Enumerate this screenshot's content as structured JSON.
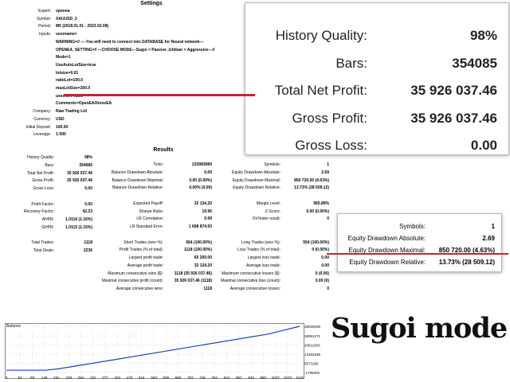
{
  "settings": {
    "title": "Settings",
    "rows": [
      {
        "label": "Expert:",
        "value": "openea"
      },
      {
        "label": "Symbol:",
        "value": "XAUUSD_2"
      },
      {
        "label": "Period:",
        "value": "M5 (2018.01.01 - 2023.02.08)"
      },
      {
        "label": "Inputs:",
        "value": "username="
      },
      {
        "label": "",
        "value": "WARNING=// ----You will need to connect into DATABASE for Neural network---"
      },
      {
        "label": "",
        "value": "OPENEA_SETTING=// ---CHOOSE MODE---Sugoi = Passive ,Ichiban = Aggressive---//"
      },
      {
        "label": "",
        "value": "Mode=1"
      },
      {
        "label": "",
        "value": "UseAutoLotSize=true"
      },
      {
        "label": "",
        "value": "lotsize=0.01"
      },
      {
        "label": "",
        "value": "ratioLot=100.0"
      },
      {
        "label": "",
        "value": "maxLotSize=200.0"
      },
      {
        "label": "",
        "value": "useAlert=false"
      },
      {
        "label": "",
        "value": "Comments=OpenEA//IorexEA"
      },
      {
        "label": "Company:",
        "value": "Raw Trading Ltd"
      },
      {
        "label": "Currency:",
        "value": "USD"
      },
      {
        "label": "Initial Deposit:",
        "value": "100.00"
      },
      {
        "label": "Leverage:",
        "value": "1:500"
      }
    ]
  },
  "results": {
    "title": "Results",
    "col1": [
      {
        "label": "History Quality:",
        "value": "98%"
      },
      {
        "label": "Bars:",
        "value": "354085"
      },
      {
        "label": "Total Net Profit:",
        "value": "35 926 037.46"
      },
      {
        "label": "Gross Profit:",
        "value": "35 926 037.46"
      },
      {
        "label": "Gross Loss:",
        "value": "0.00"
      },
      {
        "label": "",
        "value": ""
      },
      {
        "label": "Profit Factor:",
        "value": "0.00"
      },
      {
        "label": "Recovery Factor:",
        "value": "42.23"
      },
      {
        "label": "AHPR:",
        "value": "1.0116 (1.16%)"
      },
      {
        "label": "GHPR:",
        "value": "1.0115 (1.15%)"
      },
      {
        "label": "",
        "value": ""
      },
      {
        "label": "Total Trades:",
        "value": "1118"
      },
      {
        "label": "Total Deals:",
        "value": "2236"
      }
    ],
    "col2": [
      {
        "label": "",
        "value": ""
      },
      {
        "label": "Ticks:",
        "value": "233983089"
      },
      {
        "label": "Balance Drawdown Absolute:",
        "value": "0.00"
      },
      {
        "label": "Balance Drawdown Maximal:",
        "value": "0.00 (0.00%)"
      },
      {
        "label": "Balance Drawdown Relative:",
        "value": "0.00% (0.00)"
      },
      {
        "label": "",
        "value": ""
      },
      {
        "label": "Expected Payoff:",
        "value": "32 134.20"
      },
      {
        "label": "Sharpe Ratio:",
        "value": "19.96"
      },
      {
        "label": "LR Correlation:",
        "value": "0.99"
      },
      {
        "label": "LR Standard Error:",
        "value": "1 608 874.93"
      },
      {
        "label": "",
        "value": ""
      },
      {
        "label": "Short Trades (won %):",
        "value": "564 (100.00%)"
      },
      {
        "label": "Profit Trades (% of total):",
        "value": "1118 (100.00%)"
      },
      {
        "label": "Largest profit trade:",
        "value": "65 200.00"
      },
      {
        "label": "Average profit trade:",
        "value": "32 134.20"
      },
      {
        "label": "Maximum consecutive wins ($):",
        "value": "1118 (35 926 037.46)"
      },
      {
        "label": "Maximal consecutive profit (count):",
        "value": "35 926 037.46 (1118)"
      },
      {
        "label": "Average consecutive wins:",
        "value": "1118"
      }
    ],
    "col3": [
      {
        "label": "",
        "value": ""
      },
      {
        "label": "Symbols:",
        "value": "1"
      },
      {
        "label": "Equity Drawdown Absolute:",
        "value": "2.69"
      },
      {
        "label": "Equity Drawdown Maximal:",
        "value": "850 720.00 (4.63%)"
      },
      {
        "label": "Equity Drawdown Relative:",
        "value": "13.73% (28 509.12)"
      },
      {
        "label": "",
        "value": ""
      },
      {
        "label": "Margin Level:",
        "value": "965.89%"
      },
      {
        "label": "Z-Score:",
        "value": "0.00 (0.00%)"
      },
      {
        "label": "OnTester result:",
        "value": "0"
      },
      {
        "label": "",
        "value": ""
      },
      {
        "label": "",
        "value": ""
      },
      {
        "label": "Long Trades (won %):",
        "value": "554 (100.00%)"
      },
      {
        "label": "Loss Trades (% of total):",
        "value": "0 (0.00%)"
      },
      {
        "label": "Largest loss trade:",
        "value": "0.00"
      },
      {
        "label": "Average loss trade:",
        "value": "0.00"
      },
      {
        "label": "Maximum consecutive losses ($):",
        "value": "0 (0.00)"
      },
      {
        "label": "Maximal consecutive loss (count):",
        "value": "0.00 (0)"
      },
      {
        "label": "Average consecutive losses:",
        "value": "0"
      }
    ]
  },
  "zoom1": {
    "rows": [
      {
        "label": "History Quality:",
        "value": "98%"
      },
      {
        "label": "Bars:",
        "value": "354085"
      },
      {
        "label": "Total Net Profit:",
        "value": "35 926 037.46"
      },
      {
        "label": "Gross Profit:",
        "value": "35 926 037.46"
      },
      {
        "label": "Gross Loss:",
        "value": "0.00"
      }
    ],
    "highlight_color": "#c0272d"
  },
  "zoom2": {
    "rows": [
      {
        "label": "Symbols:",
        "value": "1"
      },
      {
        "label": "Equity Drawdown Absolute:",
        "value": "2.69"
      },
      {
        "label": "Equity Drawdown Maximal:",
        "value": "850 720.00 (4.63%)"
      },
      {
        "label": "Equity Drawdown Relative:",
        "value": "13.73% (28 509.12)"
      }
    ]
  },
  "caption": "Sugoi mode",
  "chart_data": {
    "type": "line",
    "title": "Balance",
    "x_ticks": [
      "0",
      "52",
      "99",
      "145",
      "191",
      "238",
      "284",
      "331",
      "377",
      "423",
      "470",
      "516",
      "563",
      "609",
      "655",
      "702",
      "748",
      "794",
      "841",
      "887",
      "934",
      "980",
      "1027",
      "1073",
      "1119"
    ],
    "y_ticks": [
      "35930639",
      "28081271",
      "20611903",
      "13162535",
      "5673166",
      "-1796202"
    ],
    "ylim": [
      -1796202,
      35930639
    ],
    "xlim": [
      0,
      1119
    ],
    "series": [
      {
        "values": [
          [
            0,
            100
          ],
          [
            150,
            200
          ],
          [
            200,
            1200000
          ],
          [
            400,
            8200000
          ],
          [
            600,
            15300000
          ],
          [
            800,
            22500000
          ],
          [
            1000,
            29600000
          ],
          [
            1119,
            35926037
          ]
        ],
        "color": "#1f3fbf"
      }
    ],
    "grid": true
  }
}
